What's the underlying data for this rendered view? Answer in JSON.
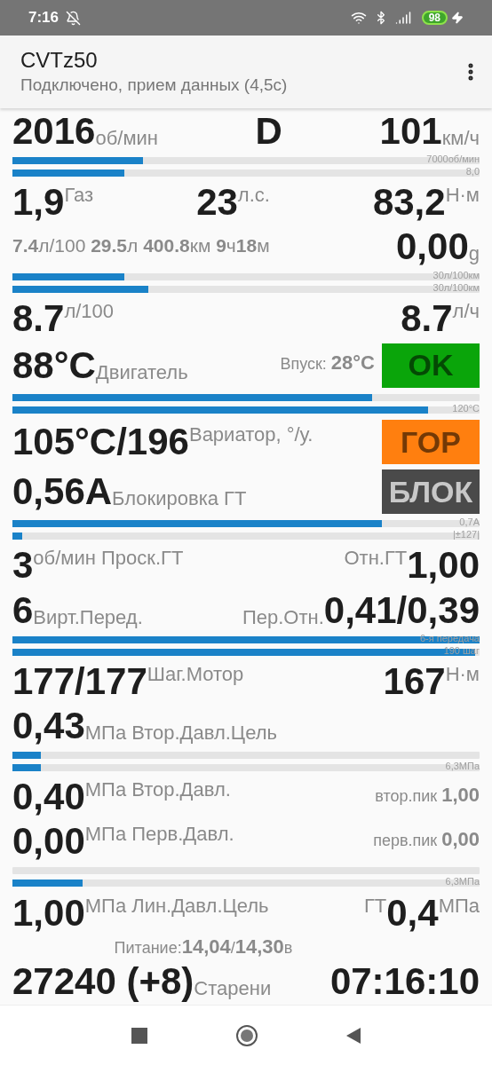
{
  "status_bar": {
    "time": "7:16",
    "battery": "98"
  },
  "app_bar": {
    "title": "CVTz50",
    "subtitle": "Подключено, прием данных (4,5с)"
  },
  "rows": [
    {
      "kind": "readings",
      "left": [
        {
          "kind": "value",
          "text": "2016"
        },
        {
          "kind": "unit_low",
          "text": "об/мин"
        }
      ],
      "center": [
        {
          "kind": "value",
          "text": "D"
        }
      ],
      "right": [
        {
          "kind": "value",
          "text": "101"
        },
        {
          "kind": "unit_low",
          "text": "км/ч"
        }
      ]
    },
    {
      "kind": "bars",
      "bars": [
        {
          "level": 0.28,
          "label": "7000об/мин"
        },
        {
          "level": 0.24,
          "label": "8,0"
        }
      ]
    },
    {
      "kind": "readings",
      "left": [
        {
          "kind": "value",
          "text": "1,9"
        },
        {
          "kind": "unit_high",
          "text": "Газ"
        }
      ],
      "center": [
        {
          "kind": "value",
          "text": "23"
        },
        {
          "kind": "unit_high",
          "text": "л.с."
        }
      ],
      "right": [
        {
          "kind": "value",
          "text": "83,2"
        },
        {
          "kind": "unit_high",
          "text": "Н·м"
        }
      ]
    },
    {
      "kind": "readings",
      "left": [
        {
          "kind": "trip",
          "text": "**7.4**л/100 **29.5**л **400.8**км **9**ч**18**м"
        }
      ],
      "right": [
        {
          "kind": "value",
          "text": "0,00"
        },
        {
          "kind": "unit_low",
          "text": "g"
        }
      ]
    },
    {
      "kind": "bars",
      "bars": [
        {
          "level": 0.24,
          "label": "30л/100км"
        },
        {
          "level": 0.29,
          "label": "30л/100км"
        }
      ]
    },
    {
      "kind": "readings",
      "left": [
        {
          "kind": "value",
          "text": "8.7"
        },
        {
          "kind": "unit_high",
          "text": "л/100"
        }
      ],
      "right": [
        {
          "kind": "value",
          "text": "8.7"
        },
        {
          "kind": "unit_high",
          "text": "л/ч"
        }
      ]
    },
    {
      "kind": "readings",
      "left": [
        {
          "kind": "value",
          "text": "88°C"
        },
        {
          "kind": "unit_low",
          "text": "Двигатель"
        }
      ],
      "right": [
        {
          "kind": "note",
          "text": "Впуск: **28°C**"
        }
      ],
      "badge": {
        "text": "OK",
        "color": "#0aa50a"
      }
    },
    {
      "kind": "bars",
      "bars": [
        {
          "level": 0.77
        },
        {
          "level": 0.89,
          "label": "120°C"
        }
      ]
    },
    {
      "kind": "readings",
      "left": [
        {
          "kind": "value",
          "text": "105°C/196"
        },
        {
          "kind": "unit_high",
          "text": "Вариатор, °/у."
        }
      ],
      "badge": {
        "text": "ГОР",
        "color": "#ff7f0f"
      }
    },
    {
      "kind": "readings",
      "left": [
        {
          "kind": "value",
          "text": "0,56А"
        },
        {
          "kind": "unit_low",
          "text": "Блокировка ГТ"
        }
      ],
      "badge": {
        "text": "БЛОК",
        "color": "#4a4a4a"
      }
    },
    {
      "kind": "bars",
      "bars": [
        {
          "level": 0.79,
          "label": "0,7А"
        },
        {
          "level": 0.02,
          "label": "|±127|"
        }
      ]
    },
    {
      "kind": "readings",
      "left": [
        {
          "kind": "value",
          "text": "3"
        },
        {
          "kind": "unit_high",
          "text": "об/мин Проск.ГТ"
        }
      ],
      "right": [
        {
          "kind": "unit_high",
          "text": "Отн.ГТ"
        },
        {
          "kind": "value",
          "text": "1,00"
        }
      ]
    },
    {
      "kind": "readings",
      "left": [
        {
          "kind": "value",
          "text": "6"
        },
        {
          "kind": "unit_low",
          "text": "Вирт.Перед."
        }
      ],
      "right": [
        {
          "kind": "unit_low",
          "text": "Пер.Отн."
        },
        {
          "kind": "value",
          "text": "0,41/0,39"
        }
      ]
    },
    {
      "kind": "bars",
      "bars": [
        {
          "level": 1.0,
          "label": "6-я передача"
        },
        {
          "level": 0.99,
          "label": "190 шаг"
        }
      ]
    },
    {
      "kind": "readings",
      "left": [
        {
          "kind": "value",
          "text": "177/177"
        },
        {
          "kind": "unit_high",
          "text": "Шаг.Мотор"
        }
      ],
      "right": [
        {
          "kind": "value",
          "text": "167"
        },
        {
          "kind": "unit_high",
          "text": "Н·м"
        }
      ]
    },
    {
      "kind": "readings",
      "left": [
        {
          "kind": "value",
          "text": "0,43"
        },
        {
          "kind": "unit_low",
          "text": "МПа Втор.Давл.Цель"
        }
      ]
    },
    {
      "kind": "bars",
      "bars": [
        {
          "level": 0.06
        },
        {
          "level": 0.06,
          "label": "6,3МПа"
        }
      ]
    },
    {
      "kind": "readings",
      "left": [
        {
          "kind": "value",
          "text": "0,40"
        },
        {
          "kind": "unit_high",
          "text": "МПа Втор.Давл."
        }
      ],
      "right": [
        {
          "kind": "note",
          "text": "втор.пик **1,00**"
        }
      ]
    },
    {
      "kind": "readings",
      "left": [
        {
          "kind": "value",
          "text": "0,00"
        },
        {
          "kind": "unit_high",
          "text": "МПа Перв.Давл."
        }
      ],
      "right": [
        {
          "kind": "note",
          "text": "перв.пик **0,00**"
        }
      ]
    },
    {
      "kind": "bars",
      "bars": [
        {
          "level": 0
        },
        {
          "level": 0.15,
          "label": "6,3МПа"
        }
      ]
    },
    {
      "kind": "readings",
      "left": [
        {
          "kind": "value",
          "text": "1,00"
        },
        {
          "kind": "unit_high",
          "text": "МПа Лин.Давл.Цель"
        }
      ],
      "right": [
        {
          "kind": "unit_high",
          "text": "ГТ"
        },
        {
          "kind": "value",
          "text": "0,4"
        },
        {
          "kind": "unit_high",
          "text": "МПа"
        }
      ]
    },
    {
      "kind": "supply",
      "text": "Питание:**14,04**/**14,30**в"
    },
    {
      "kind": "readings",
      "left": [
        {
          "kind": "value",
          "text": "27240 (+8)"
        },
        {
          "kind": "unit_low",
          "text": "Старени"
        }
      ],
      "right": [
        {
          "kind": "value",
          "text": "07:16:10"
        }
      ]
    }
  ]
}
